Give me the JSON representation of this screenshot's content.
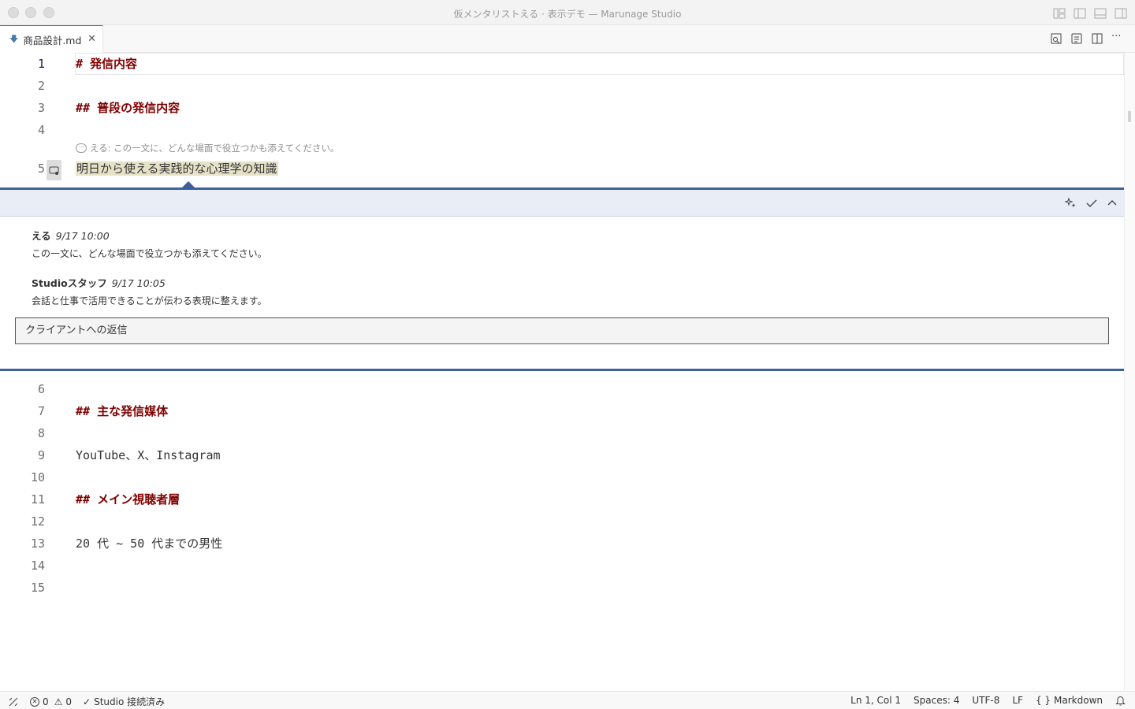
{
  "window": {
    "title": "仮メンタリストえる · 表示デモ — Marunage Studio"
  },
  "tabs": [
    {
      "label": "商品設計.md",
      "icon": "markdown-file-icon",
      "active": true
    }
  ],
  "editor": {
    "lines_before": [
      {
        "number": "1",
        "text": "# 発信内容",
        "kind": "heading",
        "active": true
      },
      {
        "number": "2",
        "text": "",
        "kind": "text"
      },
      {
        "number": "3",
        "text": "## 普段の発信内容",
        "kind": "heading"
      },
      {
        "number": "4",
        "text": "",
        "kind": "text"
      },
      {
        "number": "5",
        "text": "明日から使える実践的な心理学の知識",
        "kind": "highlighted"
      }
    ],
    "inline_hint": "える: この一文に、どんな場面で役立つかも添えてください。",
    "lines_after": [
      {
        "number": "6",
        "text": ""
      },
      {
        "number": "7",
        "text": "## 主な発信媒体",
        "kind": "heading"
      },
      {
        "number": "8",
        "text": ""
      },
      {
        "number": "9",
        "text": "YouTube、X、Instagram"
      },
      {
        "number": "10",
        "text": ""
      },
      {
        "number": "11",
        "text": "## メイン視聴者層",
        "kind": "heading"
      },
      {
        "number": "12",
        "text": ""
      },
      {
        "number": "13",
        "text": "20 代 ~ 50 代までの男性"
      },
      {
        "number": "14",
        "text": ""
      },
      {
        "number": "15",
        "text": ""
      }
    ]
  },
  "comment_thread": {
    "comments": [
      {
        "author": "える",
        "timestamp": "9/17 10:00",
        "body": "この一文に、どんな場面で役立つかも添えてください。"
      },
      {
        "author": "Studioスタッフ",
        "timestamp": "9/17 10:05",
        "body": "会話と仕事で活用できることが伝わる表現に整えます。"
      }
    ],
    "reply_placeholder": "クライアントへの返信"
  },
  "statusbar": {
    "connection": "Studio 接続済み",
    "errors": "0",
    "warnings": "0",
    "position": "Ln 1, Col 1",
    "spaces": "Spaces: 4",
    "encoding": "UTF-8",
    "eol": "LF",
    "language": "Markdown"
  }
}
